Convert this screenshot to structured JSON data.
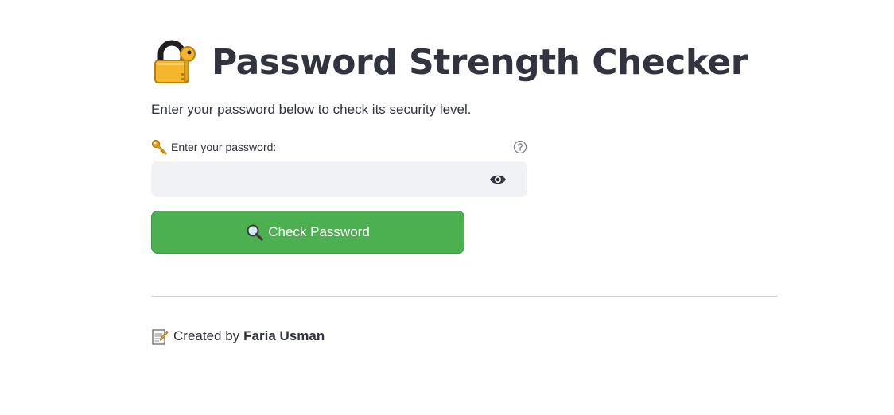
{
  "header": {
    "title": "Password Strength Checker",
    "title_icon": "locked-with-key-icon"
  },
  "intro": {
    "text": "Enter your password below to check its security level."
  },
  "password_field": {
    "label_icon": "key-icon",
    "label": "Enter your password:",
    "value": "",
    "placeholder": "",
    "help_icon": "question-circle-icon",
    "toggle_icon": "eye-icon"
  },
  "check_button": {
    "icon": "magnifying-glass-icon",
    "label": "Check Password",
    "color": "#4caf50"
  },
  "footer": {
    "icon": "memo-icon",
    "prefix": "Created by",
    "author": "Faria Usman"
  },
  "colors": {
    "text": "#31333f",
    "input_bg": "#f0f2f6",
    "button_green": "#4caf50",
    "divider": "#d6d6d9"
  }
}
